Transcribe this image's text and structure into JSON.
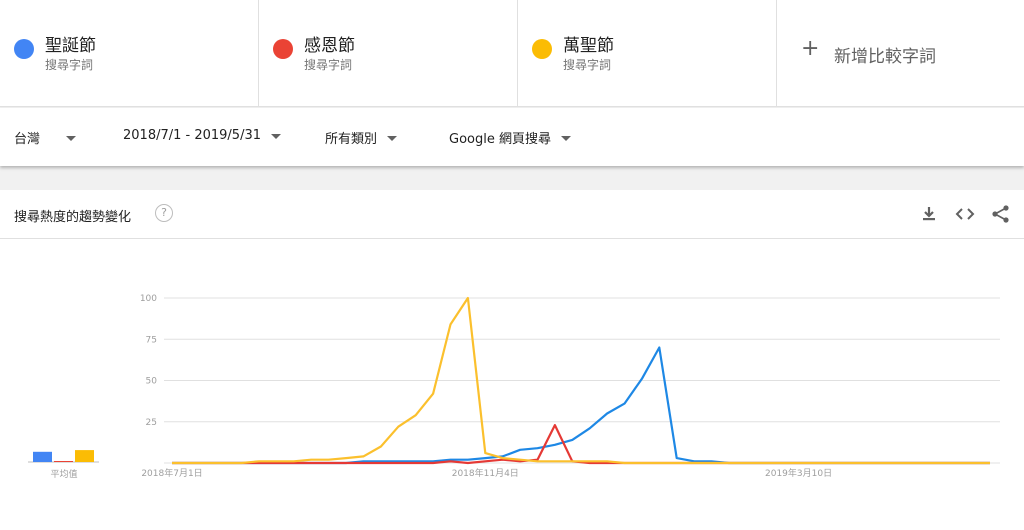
{
  "terms": [
    {
      "name": "聖誕節",
      "sub": "搜尋字詞",
      "color": "#4285f4"
    },
    {
      "name": "感恩節",
      "sub": "搜尋字詞",
      "color": "#ea4335"
    },
    {
      "name": "萬聖節",
      "sub": "搜尋字詞",
      "color": "#fbbc04"
    }
  ],
  "add_compare": {
    "label": "新增比較字詞",
    "icon": "plus-icon"
  },
  "filters": {
    "region": "台灣",
    "date_range": "2018/7/1 - 2019/5/31",
    "category": "所有類別",
    "search_type": "Google 網頁搜尋"
  },
  "card": {
    "title": "搜尋熱度的趨勢變化",
    "help_icon": "?",
    "tools": [
      "download-icon",
      "embed-icon",
      "share-icon"
    ]
  },
  "chart_data": {
    "type": "line",
    "title": "",
    "xlabel": "",
    "ylabel": "",
    "ylim": [
      0,
      100
    ],
    "yticks": [
      25,
      50,
      75,
      100
    ],
    "x_tick_labels": [
      "2018年7月1日",
      "2018年11月4日",
      "2019年3月10日"
    ],
    "x_tick_index": [
      0,
      18,
      36
    ],
    "average_label": "平均值",
    "averages": [
      {
        "name": "聖誕節",
        "value": 6,
        "color": "#4285f4"
      },
      {
        "name": "感恩節",
        "value": 0.5,
        "color": "#ea4335"
      },
      {
        "name": "萬聖節",
        "value": 7,
        "color": "#fbbc04"
      }
    ],
    "series": [
      {
        "name": "聖誕節",
        "color": "#1e88e5",
        "values": [
          0,
          0,
          0,
          0,
          0,
          0,
          0,
          0,
          0,
          0,
          0,
          1,
          1,
          1,
          1,
          1,
          2,
          2,
          3,
          4,
          8,
          9,
          11,
          14,
          21,
          30,
          36,
          51,
          70,
          3,
          1,
          1,
          0,
          0,
          0,
          0,
          0,
          0,
          0,
          0,
          0,
          0,
          0,
          0,
          0,
          0,
          0,
          0
        ]
      },
      {
        "name": "感恩節",
        "color": "#e53935",
        "values": [
          0,
          0,
          0,
          0,
          0,
          0,
          0,
          0,
          0,
          0,
          0,
          0,
          0,
          0,
          0,
          0,
          1,
          0,
          1,
          2,
          1,
          2,
          23,
          1,
          0,
          0,
          0,
          0,
          0,
          0,
          0,
          0,
          0,
          0,
          0,
          0,
          0,
          0,
          0,
          0,
          0,
          0,
          0,
          0,
          0,
          0,
          0,
          0
        ]
      },
      {
        "name": "萬聖節",
        "color": "#fbc02d",
        "values": [
          0,
          0,
          0,
          0,
          0,
          1,
          1,
          1,
          2,
          2,
          3,
          4,
          10,
          22,
          29,
          42,
          84,
          100,
          6,
          3,
          2,
          1,
          1,
          1,
          1,
          1,
          0,
          0,
          0,
          0,
          0,
          0,
          0,
          0,
          0,
          0,
          0,
          0,
          0,
          0,
          0,
          0,
          0,
          0,
          0,
          0,
          0,
          0
        ]
      }
    ]
  }
}
